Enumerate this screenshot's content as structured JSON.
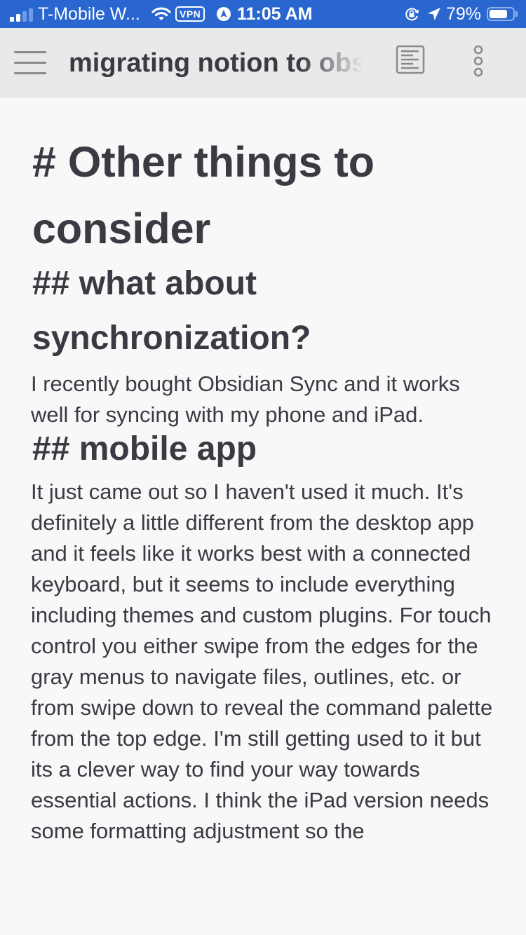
{
  "status_bar": {
    "carrier": "T-Mobile W...",
    "vpn_label": "VPN",
    "time": "11:05 AM",
    "battery_percent": "79%",
    "battery_level": 0.79,
    "signal_bars_active": 2,
    "signal_bars_total": 4,
    "icons": [
      "signal-icon",
      "wifi-icon",
      "vpn-icon",
      "navigation-app-icon",
      "rotation-lock-icon",
      "location-arrow-icon",
      "battery-icon"
    ],
    "background_color": "#2a66cf"
  },
  "app_bar": {
    "menu_icon": "hamburger-menu-icon",
    "title": "migrating notion to obsidian",
    "reader_icon": "reading-view-icon",
    "more_icon": "more-options-vertical-icon"
  },
  "document": {
    "heading1": "# Other things to consider",
    "sections": [
      {
        "heading": "## what about synchronization?",
        "body": "I recently bought Obsidian Sync and it works well for syncing with my phone and iPad."
      },
      {
        "heading": "## mobile app",
        "body": "It just came out so I haven't used it much. It's definitely a little different from the desktop app and it feels like it works best with a connected keyboard, but it seems to include everything including themes and custom plugins. For touch control you either swipe from the edges for the gray menus to navigate files, outlines, etc. or from swipe down to reveal the command palette from the top edge. I'm still getting used to it but its a clever way to find your way towards essential actions. I think the iPad version needs some formatting adjustment so the"
      }
    ]
  }
}
